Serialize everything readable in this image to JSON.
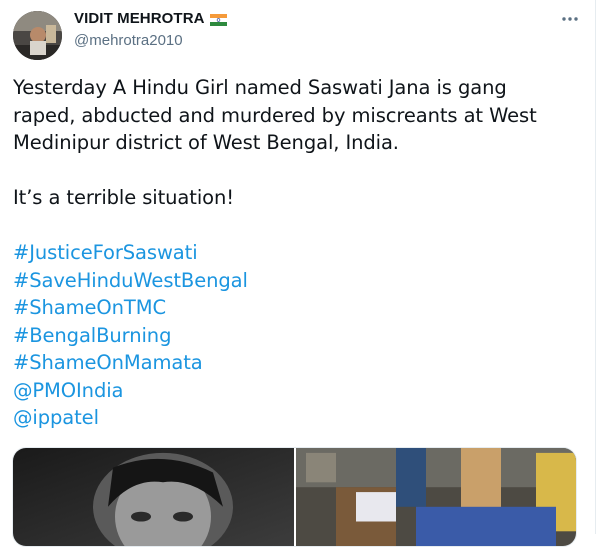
{
  "tweet": {
    "author_name": "VIDIT MEHROTRA",
    "author_handle": "@mehrotra2010",
    "text_lines": [
      "Yesterday A Hindu Girl named Saswati Jana is gang",
      "raped, abducted and murdered by miscreants at West",
      "Medinipur district of West Bengal, India."
    ],
    "text_line2": "It’s a terrible situation!",
    "hashtags": [
      "#JusticeForSaswati",
      "#SaveHinduWestBengal",
      "#ShameOnTMC",
      "#BengalBurning",
      "#ShameOnMamata"
    ],
    "mentions": [
      "@PMOIndia",
      "@ippatel"
    ]
  },
  "icons": {
    "more": "more-options-icon",
    "flag": "india-flag-icon"
  },
  "colors": {
    "link": "#1b95e0",
    "text": "#0f1419",
    "secondary": "#5b7083"
  }
}
